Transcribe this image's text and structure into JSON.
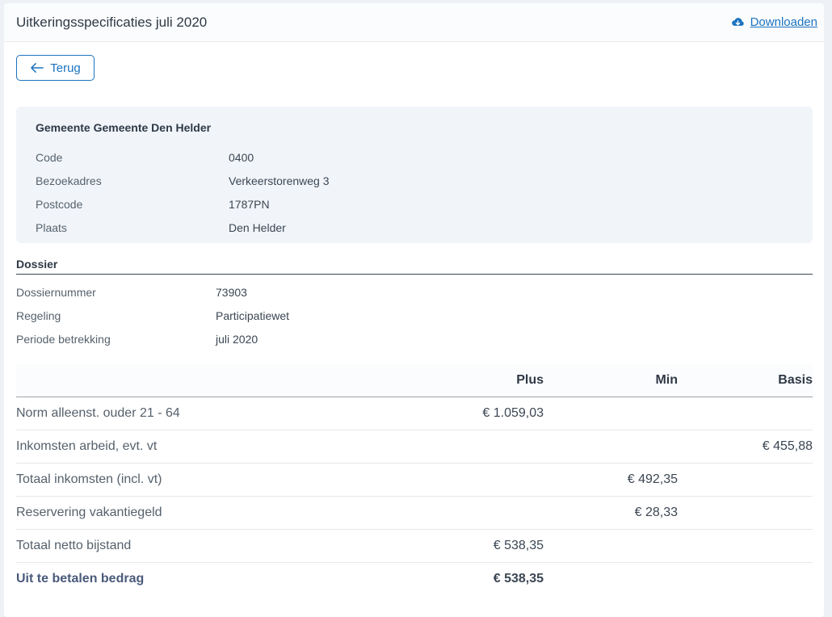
{
  "header": {
    "title": "Uitkeringsspecificaties juli 2020",
    "download_label": "Downloaden"
  },
  "back_button": {
    "label": "Terug"
  },
  "organisation": {
    "name": "Gemeente Gemeente Den Helder",
    "fields": [
      {
        "label": "Code",
        "value": "0400"
      },
      {
        "label": "Bezoekadres",
        "value": "Verkeerstorenweg 3"
      },
      {
        "label": "Postcode",
        "value": "1787PN"
      },
      {
        "label": "Plaats",
        "value": "Den Helder"
      }
    ]
  },
  "dossier": {
    "title": "Dossier",
    "fields": [
      {
        "label": "Dossiernummer",
        "value": "73903"
      },
      {
        "label": "Regeling",
        "value": "Participatiewet"
      },
      {
        "label": "Periode betrekking",
        "value": "juli 2020"
      }
    ]
  },
  "specification": {
    "columns": [
      "",
      "Plus",
      "Min",
      "Basis"
    ],
    "rows": [
      {
        "description": "Norm alleenst. ouder 21 - 64",
        "plus": "€ 1.059,03",
        "min": "",
        "basis": ""
      },
      {
        "description": "Inkomsten arbeid, evt. vt",
        "plus": "",
        "min": "",
        "basis": "€ 455,88"
      },
      {
        "description": "Totaal inkomsten (incl. vt)",
        "plus": "",
        "min": "€ 492,35",
        "basis": ""
      },
      {
        "description": "Reservering vakantiegeld",
        "plus": "",
        "min": "€ 28,33",
        "basis": ""
      },
      {
        "description": "Totaal netto bijstand",
        "plus": "€ 538,35",
        "min": "",
        "basis": ""
      },
      {
        "description": "Uit te betalen bedrag",
        "plus": "€ 538,35",
        "min": "",
        "basis": ""
      }
    ]
  },
  "colors": {
    "accent": "#1a73c0",
    "card_background": "#f1f5fa",
    "page_background": "#eef1f6"
  },
  "icons": {
    "download": "cloud-download-icon",
    "back": "arrow-left-icon"
  }
}
